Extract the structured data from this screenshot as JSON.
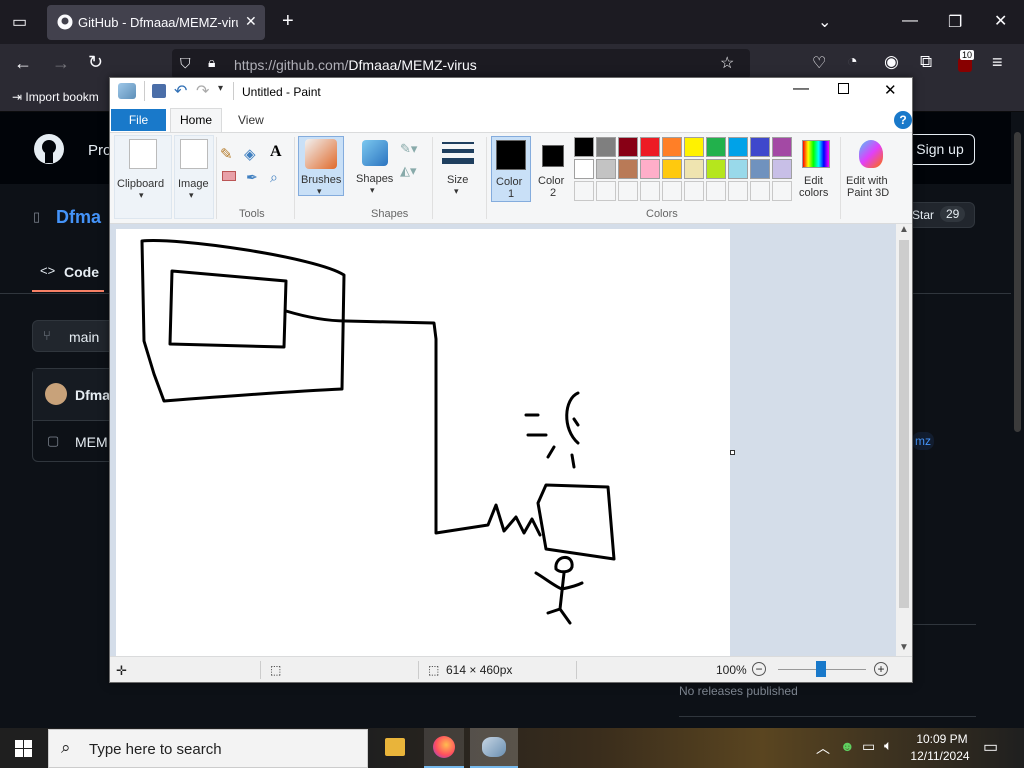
{
  "browser": {
    "tab_title": "GitHub - Dfmaaa/MEMZ-virus",
    "url_host": "https://github.com/",
    "url_path": "Dfmaaa/MEMZ-virus",
    "bookmark": "Import bookm",
    "badge": "10"
  },
  "github": {
    "product_text": "Pro",
    "repo_owner": "Dfma",
    "tab_code": "Code",
    "branch": "main",
    "commit_author": "Dfma",
    "file_name": "MEM",
    "sign_up": "Sign up",
    "star": "Star",
    "star_count": "29",
    "topic": "mz",
    "releases": "No releases published"
  },
  "paint": {
    "title": "Untitled - Paint",
    "tabs": [
      "File",
      "Home",
      "View"
    ],
    "clipboard": "Clipboard",
    "image": "Image",
    "tools": "Tools",
    "brushes": "Brushes",
    "shapes_btn": "Shapes",
    "shapes_group": "Shapes",
    "size": "Size",
    "color1": "Color",
    "color1_num": "1",
    "color2": "Color",
    "color2_num": "2",
    "colors_group": "Colors",
    "edit_colors_1": "Edit",
    "edit_colors_2": "colors",
    "paint3d_1": "Edit with",
    "paint3d_2": "Paint 3D",
    "text_tool": "A",
    "canvas_size": "614 × 460px",
    "zoom": "100%",
    "palette_row1": [
      "#000000",
      "#7f7f7f",
      "#880015",
      "#ed1c24",
      "#ff7f27",
      "#fff200",
      "#22b14c",
      "#00a2e8",
      "#3f48cc",
      "#a349a4"
    ],
    "palette_row2": [
      "#ffffff",
      "#c3c3c3",
      "#b97a57",
      "#ffaec9",
      "#ffc90e",
      "#efe4b0",
      "#b5e61d",
      "#99d9ea",
      "#7092be",
      "#c8bfe7"
    ]
  },
  "taskbar": {
    "search": "Type here to search",
    "time": "10:09 PM",
    "date": "12/11/2024"
  }
}
